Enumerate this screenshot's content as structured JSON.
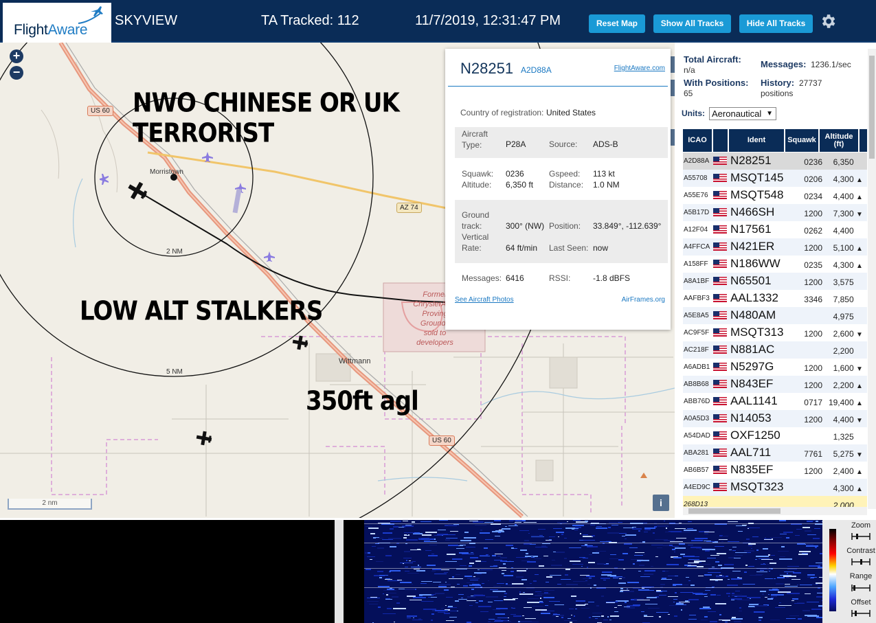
{
  "header": {
    "logo": "FlightAware",
    "app_name": "SKYVIEW",
    "tracked": "TA Tracked: 112",
    "datetime": "11/7/2019, 12:31:47 PM",
    "reset_map": "Reset Map",
    "show_all_tracks": "Show All Tracks",
    "hide_all_tracks": "Hide All Tracks",
    "settings_icon": "gear-icon"
  },
  "map": {
    "zoom_in": "+",
    "zoom_out": "−",
    "overlay_1": "NWO CHINESE OR UK",
    "overlay_2": "TERRORIST",
    "overlay_3": "LOW ALT STALKERS",
    "overlay_4": "350ft agl",
    "place_morristown": "Morristown",
    "place_wittmann": "Wittmann",
    "route_us60_a": "US 60",
    "route_us60_b": "US 60",
    "route_az74": "AZ 74",
    "ring_2nm": "2 NM",
    "ring_5nm": "5 NM",
    "poi_line1": "Former",
    "poi_line2": "ChryslerAuto",
    "poi_line3": "Proving",
    "poi_line4": "Grounds",
    "poi_line5": "sold to",
    "poi_line6": "developers",
    "scale": "2 nm",
    "info": "i"
  },
  "popup": {
    "ident": "N28251",
    "icao": "A2D88A",
    "fa_link": "FlightAware.com",
    "country_label": "Country of registration:",
    "country_value": "United States",
    "aircraft_type_label": "Aircraft Type:",
    "aircraft_type_value": "P28A",
    "source_label": "Source:",
    "source_value": "ADS-B",
    "squawk_label": "Squawk:",
    "squawk_value": "0236",
    "gspeed_label": "Gspeed:",
    "gspeed_value": "113 kt",
    "altitude_label": "Altitude:",
    "altitude_value": "6,350 ft",
    "distance_label": "Distance:",
    "distance_value": "1.0 NM",
    "ground_track_label": "Ground track:",
    "ground_track_value": "300° (NW)",
    "position_label": "Position:",
    "position_value": "33.849°, -112.639°",
    "vrate_label": "Vertical Rate:",
    "vrate_value": "64 ft/min",
    "last_seen_label": "Last Seen:",
    "last_seen_value": "now",
    "messages_label": "Messages:",
    "messages_value": "6416",
    "rssi_label": "RSSI:",
    "rssi_value": "-1.8 dBFS",
    "photos_link": "See Aircraft Photos",
    "airframes_link": "AirFrames.org"
  },
  "sidebar": {
    "total_label": "Total Aircraft:",
    "total_value": "n/a",
    "messages_label": "Messages:",
    "messages_value": "1236.1/sec",
    "positions_label": "With Positions:",
    "positions_value": "65",
    "history_label": "History:",
    "history_value": "27737",
    "history_unit": "positions",
    "units_label": "Units:",
    "units_value": "Aeronautical",
    "columns": [
      "ICAO",
      "Ident",
      "Squawk",
      "Altitude (ft)"
    ],
    "rows": [
      {
        "icao": "A2D88A",
        "ident": "N28251",
        "squawk": "0236",
        "alt": "6,350",
        "trend": ""
      },
      {
        "icao": "A55708",
        "ident": "MSQT145",
        "squawk": "0206",
        "alt": "4,300",
        "trend": "▲"
      },
      {
        "icao": "A55E76",
        "ident": "MSQT548",
        "squawk": "0234",
        "alt": "4,400",
        "trend": "▲"
      },
      {
        "icao": "A5B17D",
        "ident": "N466SH",
        "squawk": "1200",
        "alt": "7,300",
        "trend": "▼"
      },
      {
        "icao": "A12F04",
        "ident": "N17561",
        "squawk": "0262",
        "alt": "4,400",
        "trend": ""
      },
      {
        "icao": "A4FFCA",
        "ident": "N421ER",
        "squawk": "1200",
        "alt": "5,100",
        "trend": "▲"
      },
      {
        "icao": "A158FF",
        "ident": "N186WW",
        "squawk": "0235",
        "alt": "4,300",
        "trend": "▲"
      },
      {
        "icao": "A8A1BF",
        "ident": "N65501",
        "squawk": "1200",
        "alt": "3,575",
        "trend": ""
      },
      {
        "icao": "AAFBF3",
        "ident": "AAL1332",
        "squawk": "3346",
        "alt": "7,850",
        "trend": ""
      },
      {
        "icao": "A5E8A5",
        "ident": "N480AM",
        "squawk": "",
        "alt": "4,975",
        "trend": ""
      },
      {
        "icao": "AC9F5F",
        "ident": "MSQT313",
        "squawk": "1200",
        "alt": "2,600",
        "trend": "▼"
      },
      {
        "icao": "AC218F",
        "ident": "N881AC",
        "squawk": "",
        "alt": "2,200",
        "trend": ""
      },
      {
        "icao": "A6ADB1",
        "ident": "N5297G",
        "squawk": "1200",
        "alt": "1,600",
        "trend": "▼"
      },
      {
        "icao": "AB8B68",
        "ident": "N843EF",
        "squawk": "1200",
        "alt": "2,200",
        "trend": "▲"
      },
      {
        "icao": "ABB76D",
        "ident": "AAL1141",
        "squawk": "0717",
        "alt": "19,400",
        "trend": "▲"
      },
      {
        "icao": "A0A5D3",
        "ident": "N14053",
        "squawk": "1200",
        "alt": "4,400",
        "trend": "▼"
      },
      {
        "icao": "A54DAD",
        "ident": "OXF1250",
        "squawk": "",
        "alt": "1,325",
        "trend": ""
      },
      {
        "icao": "ABA281",
        "ident": "AAL711",
        "squawk": "7761",
        "alt": "5,275",
        "trend": "▼"
      },
      {
        "icao": "AB6B57",
        "ident": "N835EF",
        "squawk": "1200",
        "alt": "2,400",
        "trend": "▲"
      },
      {
        "icao": "A4ED9C",
        "ident": "MSQT323",
        "squawk": "",
        "alt": "4,300",
        "trend": "▲"
      },
      {
        "icao": "268D13",
        "ident": "",
        "squawk": "",
        "alt": "2,000",
        "trend": ""
      }
    ]
  },
  "waterfall": {
    "zoom": "Zoom",
    "contrast": "Contrast",
    "range": "Range",
    "offset": "Offset"
  }
}
